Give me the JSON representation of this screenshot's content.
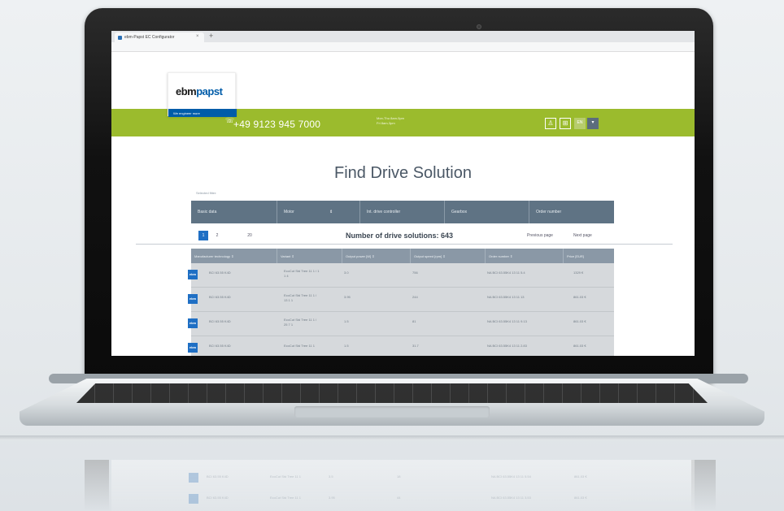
{
  "browser": {
    "tab_title": "ebm-Papst EC Configurator",
    "tab_close": "×",
    "new_tab": "+"
  },
  "brand": {
    "logo_prefix": "ebm",
    "logo_suffix": "papst",
    "badge": "We engineer more",
    "blue": "#005ca9",
    "green": "#9bbb2d"
  },
  "header": {
    "phone_icon": "phone-icon",
    "phone": "+49 9123 945 7000",
    "hours_line1": "Mon-Thu 8am-5pm",
    "hours_line2": "Fri 8am-3pm",
    "user_glyph": "♙",
    "cart_glyph": "⊞",
    "lang_label": "EN",
    "dropdown_glyph": "▾"
  },
  "main": {
    "title": "Find Drive Solution",
    "selected_filter_label": "Selected filter:",
    "filters": [
      {
        "label": "Basic data"
      },
      {
        "label": "Motor",
        "sort": "⇕"
      },
      {
        "label": "Int. drive controller"
      },
      {
        "label": "Gearbox"
      },
      {
        "label": "Order number"
      }
    ],
    "pagination": {
      "page1": "1",
      "page2": "2",
      "last_page": "20",
      "count_text": "Number of drive solutions: 643",
      "prev": "Previous page",
      "next": "Next page"
    },
    "columns": [
      "Manufacturer technology",
      "Variant",
      "Output power [W]",
      "Output speed [rpm]",
      "Order number",
      "Price [EUR]"
    ],
    "rows": [
      {
        "icon_label": "ebm",
        "technology": "BCI 63.55 K4D",
        "variant": "EcoCut Std Tree 11 1  / 1 1 4",
        "power": "3.0",
        "speed": "756",
        "order": "NA BCI 63.55K4 13 11 5.4",
        "price": "1329 €"
      },
      {
        "icon_label": "ebm",
        "technology": "BCI 63.55 K4D",
        "variant": "EcoCut Std Tree 11 1  / 13 1 1",
        "power": "3.95",
        "speed": "244",
        "order": "NA BCI 63.55K4 13 11 13",
        "price": "861.03 €"
      },
      {
        "icon_label": "ebm",
        "technology": "BCI 63.55 K4D",
        "variant": "EcoCut Std Tree 11 1  / 25 7 1",
        "power": "1.5",
        "speed": "81",
        "order": "NA BCI 63.55K4 13 11 9.13",
        "price": "861.03 €"
      },
      {
        "icon_label": "ebm",
        "technology": "BCI 63.55 K4D",
        "variant": "EcoCut Std Tree 11 1",
        "power": "1.5",
        "speed": "31.7",
        "order": "NA BCI 63.55K4 13 11 2.83",
        "price": "861.03 €"
      }
    ]
  },
  "reflection": {
    "rows": [
      {
        "icon_label": "ebm",
        "technology": "BCI 63.55 K4D",
        "variant": "EcoCut Std Tree 11 1",
        "power": "3.5",
        "speed": "18",
        "order": "NA BCI 63.55K4 13 11 5.54",
        "price": "861.03 €"
      },
      {
        "icon_label": "ebm",
        "technology": "BCI 63.55 K4D",
        "variant": "EcoCut Std Tree 11 1",
        "power": "3.95",
        "speed": "44",
        "order": "NA BCI 63.55K4 13 11 3.53",
        "price": "861.03 €"
      }
    ]
  }
}
